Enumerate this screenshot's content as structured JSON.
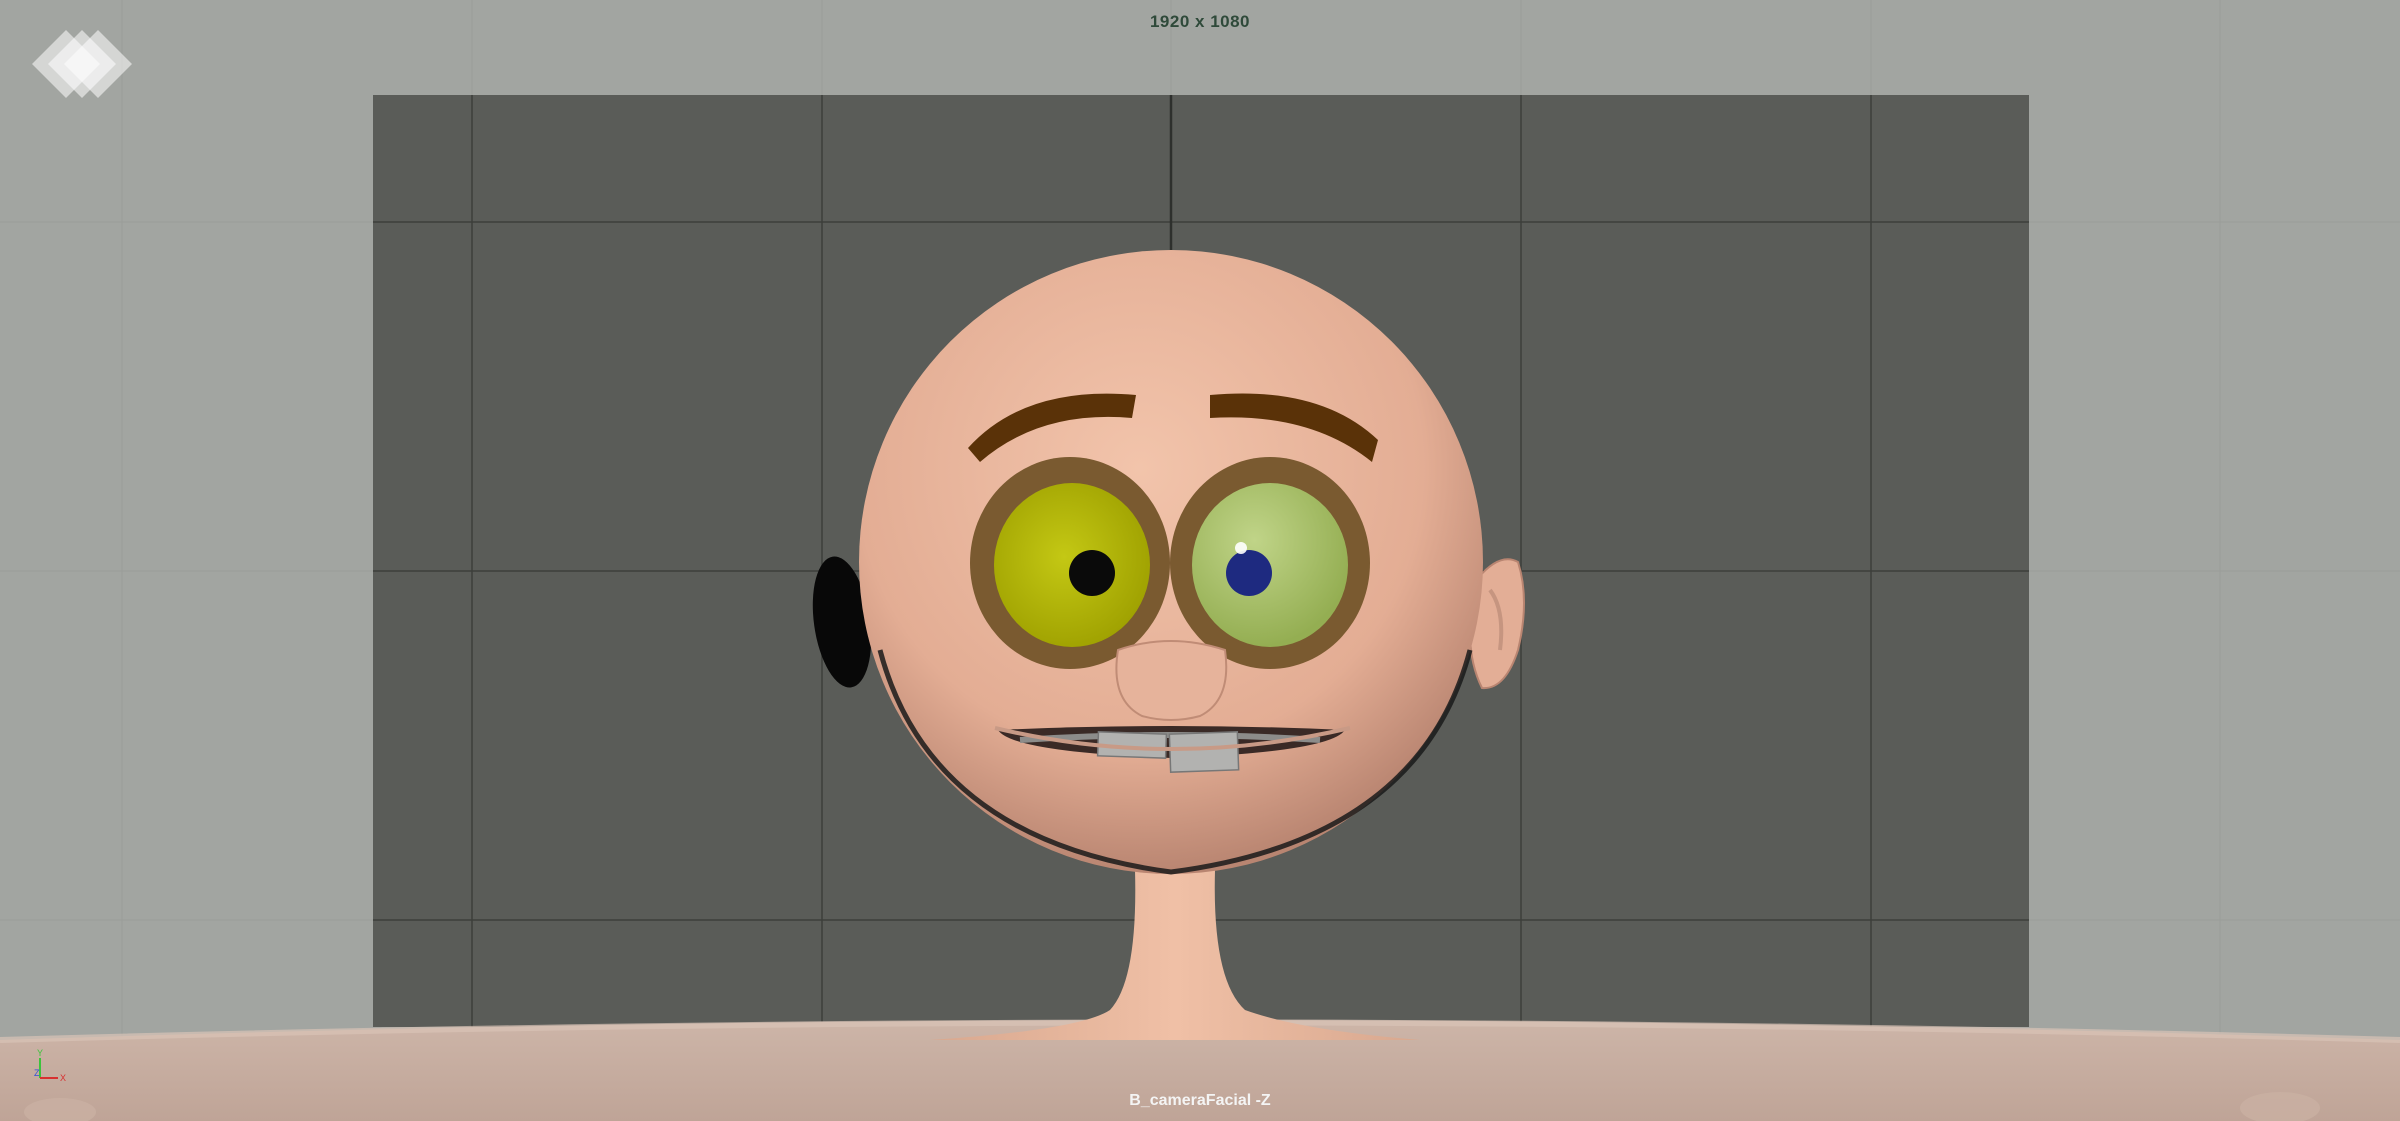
{
  "viewport": {
    "resolution": "1920 x 1080",
    "camera": "B_cameraFacial -Z"
  },
  "icons": {
    "logo": "maya-logo-icon",
    "axis": "view-axis-gizmo-icon"
  },
  "axis_labels": {
    "y": "Y",
    "z": "Z",
    "x": "X"
  },
  "colors": {
    "viewport_background": "#a2a5a1",
    "resolution_gate": "#5a5c58",
    "grid_line": "#3c3e3b",
    "skin": "#e8b79e",
    "eyebrow": "#5a3208",
    "eye_rim": "#7a5a30",
    "left_eye": "#b4b800",
    "right_eye": "#a8c060",
    "left_pupil": "#0a0a0a",
    "right_pupil": "#1e2a80",
    "teeth": "#b2b2b0"
  }
}
